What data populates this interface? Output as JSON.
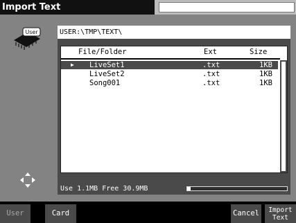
{
  "window": {
    "title": "Import Text"
  },
  "path": {
    "value": "USER:\\TMP\\TEXT\\"
  },
  "chip": {
    "label": "User"
  },
  "table": {
    "headers": {
      "name": "File/Folder",
      "ext": "Ext",
      "size": "Size"
    },
    "rows": [
      {
        "name": "LiveSet1",
        "ext": ".txt",
        "size": "1KB",
        "selected": true
      },
      {
        "name": "LiveSet2",
        "ext": ".txt",
        "size": "1KB",
        "selected": false
      },
      {
        "name": "Song001",
        "ext": ".txt",
        "size": "1KB",
        "selected": false
      }
    ],
    "selected_marker": "▶"
  },
  "status": {
    "usage": "Use 1.1MB  Free 30.9MB",
    "meter_fraction": 0.035
  },
  "footer": {
    "user": "User",
    "card": "Card",
    "cancel": "Cancel",
    "import_line1": "Import",
    "import_line2": "Text"
  },
  "colors": {
    "selected_row": "#4a4a4a",
    "title_bg": "#111111",
    "panel": "#4a4a4a"
  }
}
